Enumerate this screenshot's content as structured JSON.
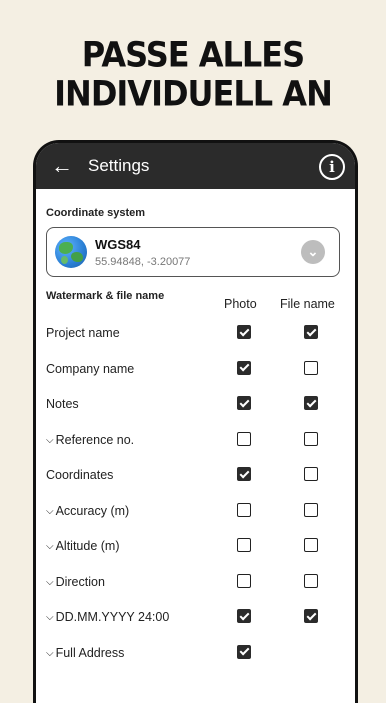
{
  "headline": {
    "line1": "PASSE ALLES",
    "line2": "INDIVIDUELL AN"
  },
  "appbar": {
    "back_icon": "arrow-left-icon",
    "title": "Settings",
    "info_icon": "info-icon",
    "info_glyph": "i"
  },
  "coordinate_system": {
    "section_label": "Coordinate system",
    "name": "WGS84",
    "value": "55.94848, -3.20077",
    "icon": "globe-icon"
  },
  "watermark": {
    "section_label": "Watermark & file name",
    "col_photo": "Photo",
    "col_filename": "File name",
    "rows": [
      {
        "label": "Project name",
        "expandable": false,
        "photo": true,
        "file": true
      },
      {
        "label": "Company name",
        "expandable": false,
        "photo": true,
        "file": false
      },
      {
        "label": "Notes",
        "expandable": false,
        "photo": true,
        "file": true
      },
      {
        "label": "Reference no.",
        "expandable": true,
        "photo": false,
        "file": false
      },
      {
        "label": "Coordinates",
        "expandable": false,
        "photo": true,
        "file": false
      },
      {
        "label": "Accuracy (m)",
        "expandable": true,
        "photo": false,
        "file": false
      },
      {
        "label": "Altitude (m)",
        "expandable": true,
        "photo": false,
        "file": false
      },
      {
        "label": "Direction",
        "expandable": true,
        "photo": false,
        "file": false
      },
      {
        "label": "DD.MM.YYYY 24:00",
        "expandable": true,
        "photo": true,
        "file": true
      },
      {
        "label": "Full Address",
        "expandable": true,
        "photo": true,
        "file": null
      }
    ]
  }
}
